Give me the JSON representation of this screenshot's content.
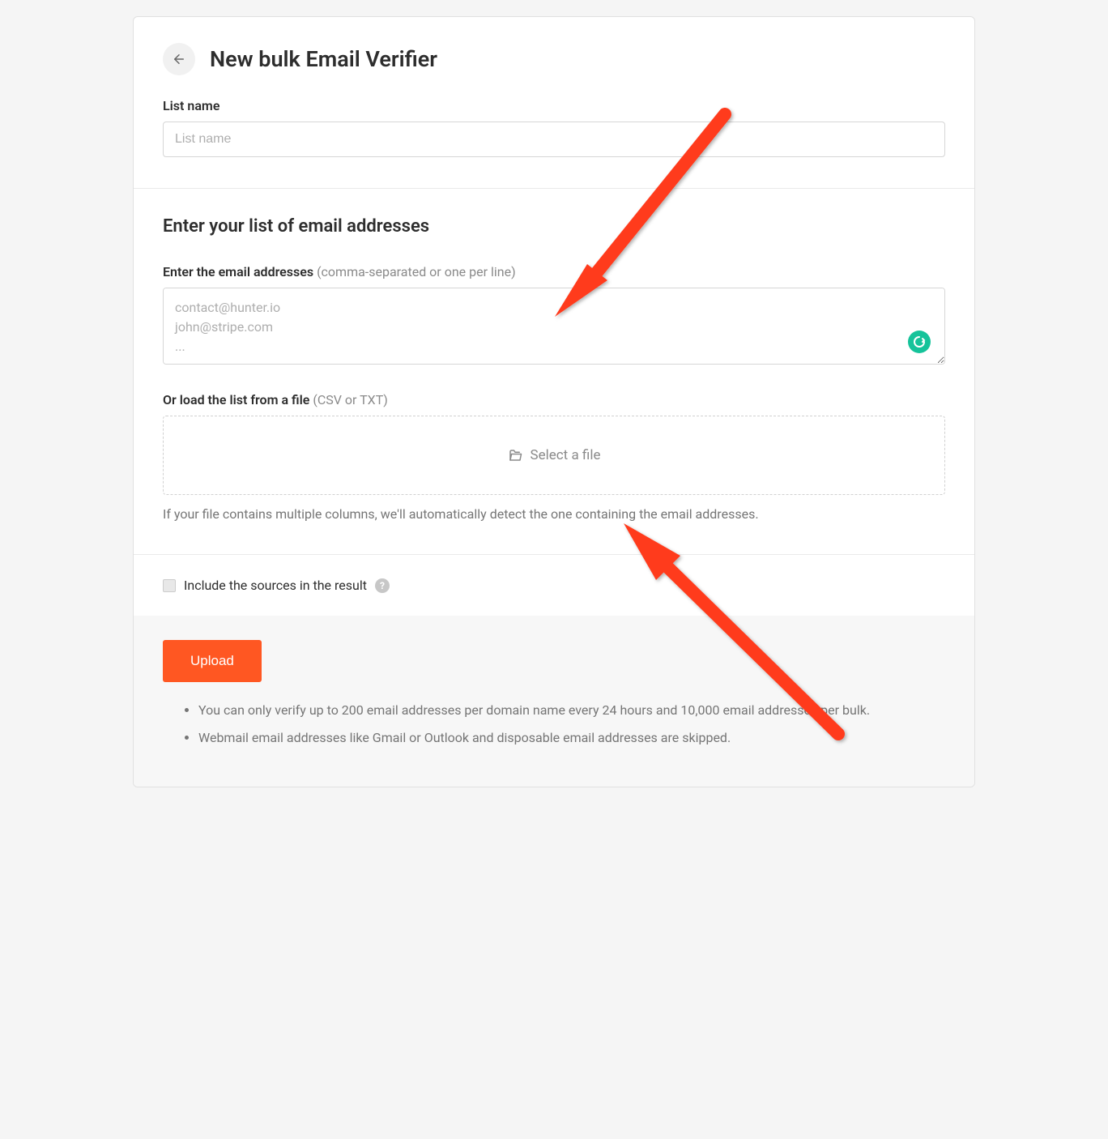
{
  "header": {
    "title": "New bulk Email Verifier"
  },
  "listName": {
    "label": "List name",
    "placeholder": "List name"
  },
  "emailSection": {
    "title": "Enter your list of email addresses",
    "enterLabel": "Enter the email addresses",
    "enterHint": "(comma-separated or one per line)",
    "textareaPlaceholder": "contact@hunter.io\njohn@stripe.com\n...",
    "fileLabel": "Or load the list from a file",
    "fileHint": "(CSV or TXT)",
    "fileButton": "Select a file",
    "fileHelp": "If your file contains multiple columns, we'll automatically detect the one containing the email addresses."
  },
  "options": {
    "includeSources": "Include the sources in the result"
  },
  "footer": {
    "uploadLabel": "Upload",
    "notes": [
      "You can only verify up to 200 email addresses per domain name every 24 hours and 10,000 email addresses per bulk.",
      "Webmail email addresses like Gmail or Outlook and disposable email addresses are skipped."
    ]
  }
}
